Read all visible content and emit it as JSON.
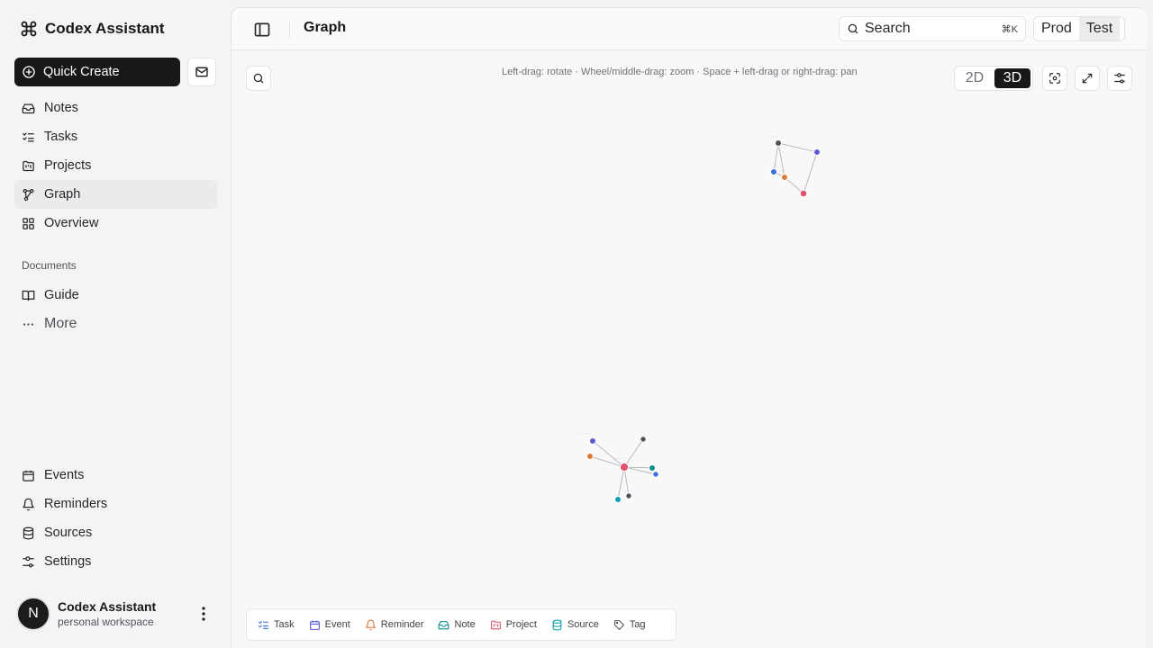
{
  "app": {
    "name": "Codex Assistant"
  },
  "sidebar": {
    "quick_create_label": "Quick Create",
    "nav": [
      {
        "label": "Notes",
        "icon": "inbox-icon"
      },
      {
        "label": "Tasks",
        "icon": "list-checks-icon"
      },
      {
        "label": "Projects",
        "icon": "folder-kanban-icon"
      },
      {
        "label": "Graph",
        "icon": "graph-icon",
        "active": true
      },
      {
        "label": "Overview",
        "icon": "layout-grid-icon"
      }
    ],
    "documents_label": "Documents",
    "documents": [
      {
        "label": "Guide",
        "icon": "book-icon"
      },
      {
        "label": "More",
        "icon": "ellipsis-icon"
      }
    ],
    "bottom_nav": [
      {
        "label": "Events",
        "icon": "calendar-icon"
      },
      {
        "label": "Reminders",
        "icon": "bell-icon"
      },
      {
        "label": "Sources",
        "icon": "database-icon"
      },
      {
        "label": "Settings",
        "icon": "settings-sliders-icon"
      }
    ],
    "user": {
      "initial": "N",
      "name": "Codex Assistant",
      "workspace": "personal workspace"
    }
  },
  "header": {
    "title": "Graph",
    "search_label": "Search",
    "search_shortcut": "⌘K",
    "environments": [
      "Prod",
      "Test"
    ],
    "active_environment": "Test"
  },
  "canvas": {
    "hint": "Left-drag: rotate · Wheel/middle-drag: zoom · Space + left-drag or right-drag: pan",
    "dimension_options": [
      "2D",
      "3D"
    ],
    "active_dimension": "3D"
  },
  "legend": [
    {
      "label": "Task",
      "color": "#3b6fd9",
      "icon": "task-icon"
    },
    {
      "label": "Event",
      "color": "#5b5bd6",
      "icon": "calendar-icon"
    },
    {
      "label": "Reminder",
      "color": "#e07b39",
      "icon": "bell-icon"
    },
    {
      "label": "Note",
      "color": "#0f8f8a",
      "icon": "inbox-icon"
    },
    {
      "label": "Project",
      "color": "#e0536f",
      "icon": "folder-kanban-icon"
    },
    {
      "label": "Source",
      "color": "#0e9fb0",
      "icon": "database-icon"
    },
    {
      "label": "Tag",
      "color": "#52525b",
      "icon": "tag-icon"
    }
  ]
}
